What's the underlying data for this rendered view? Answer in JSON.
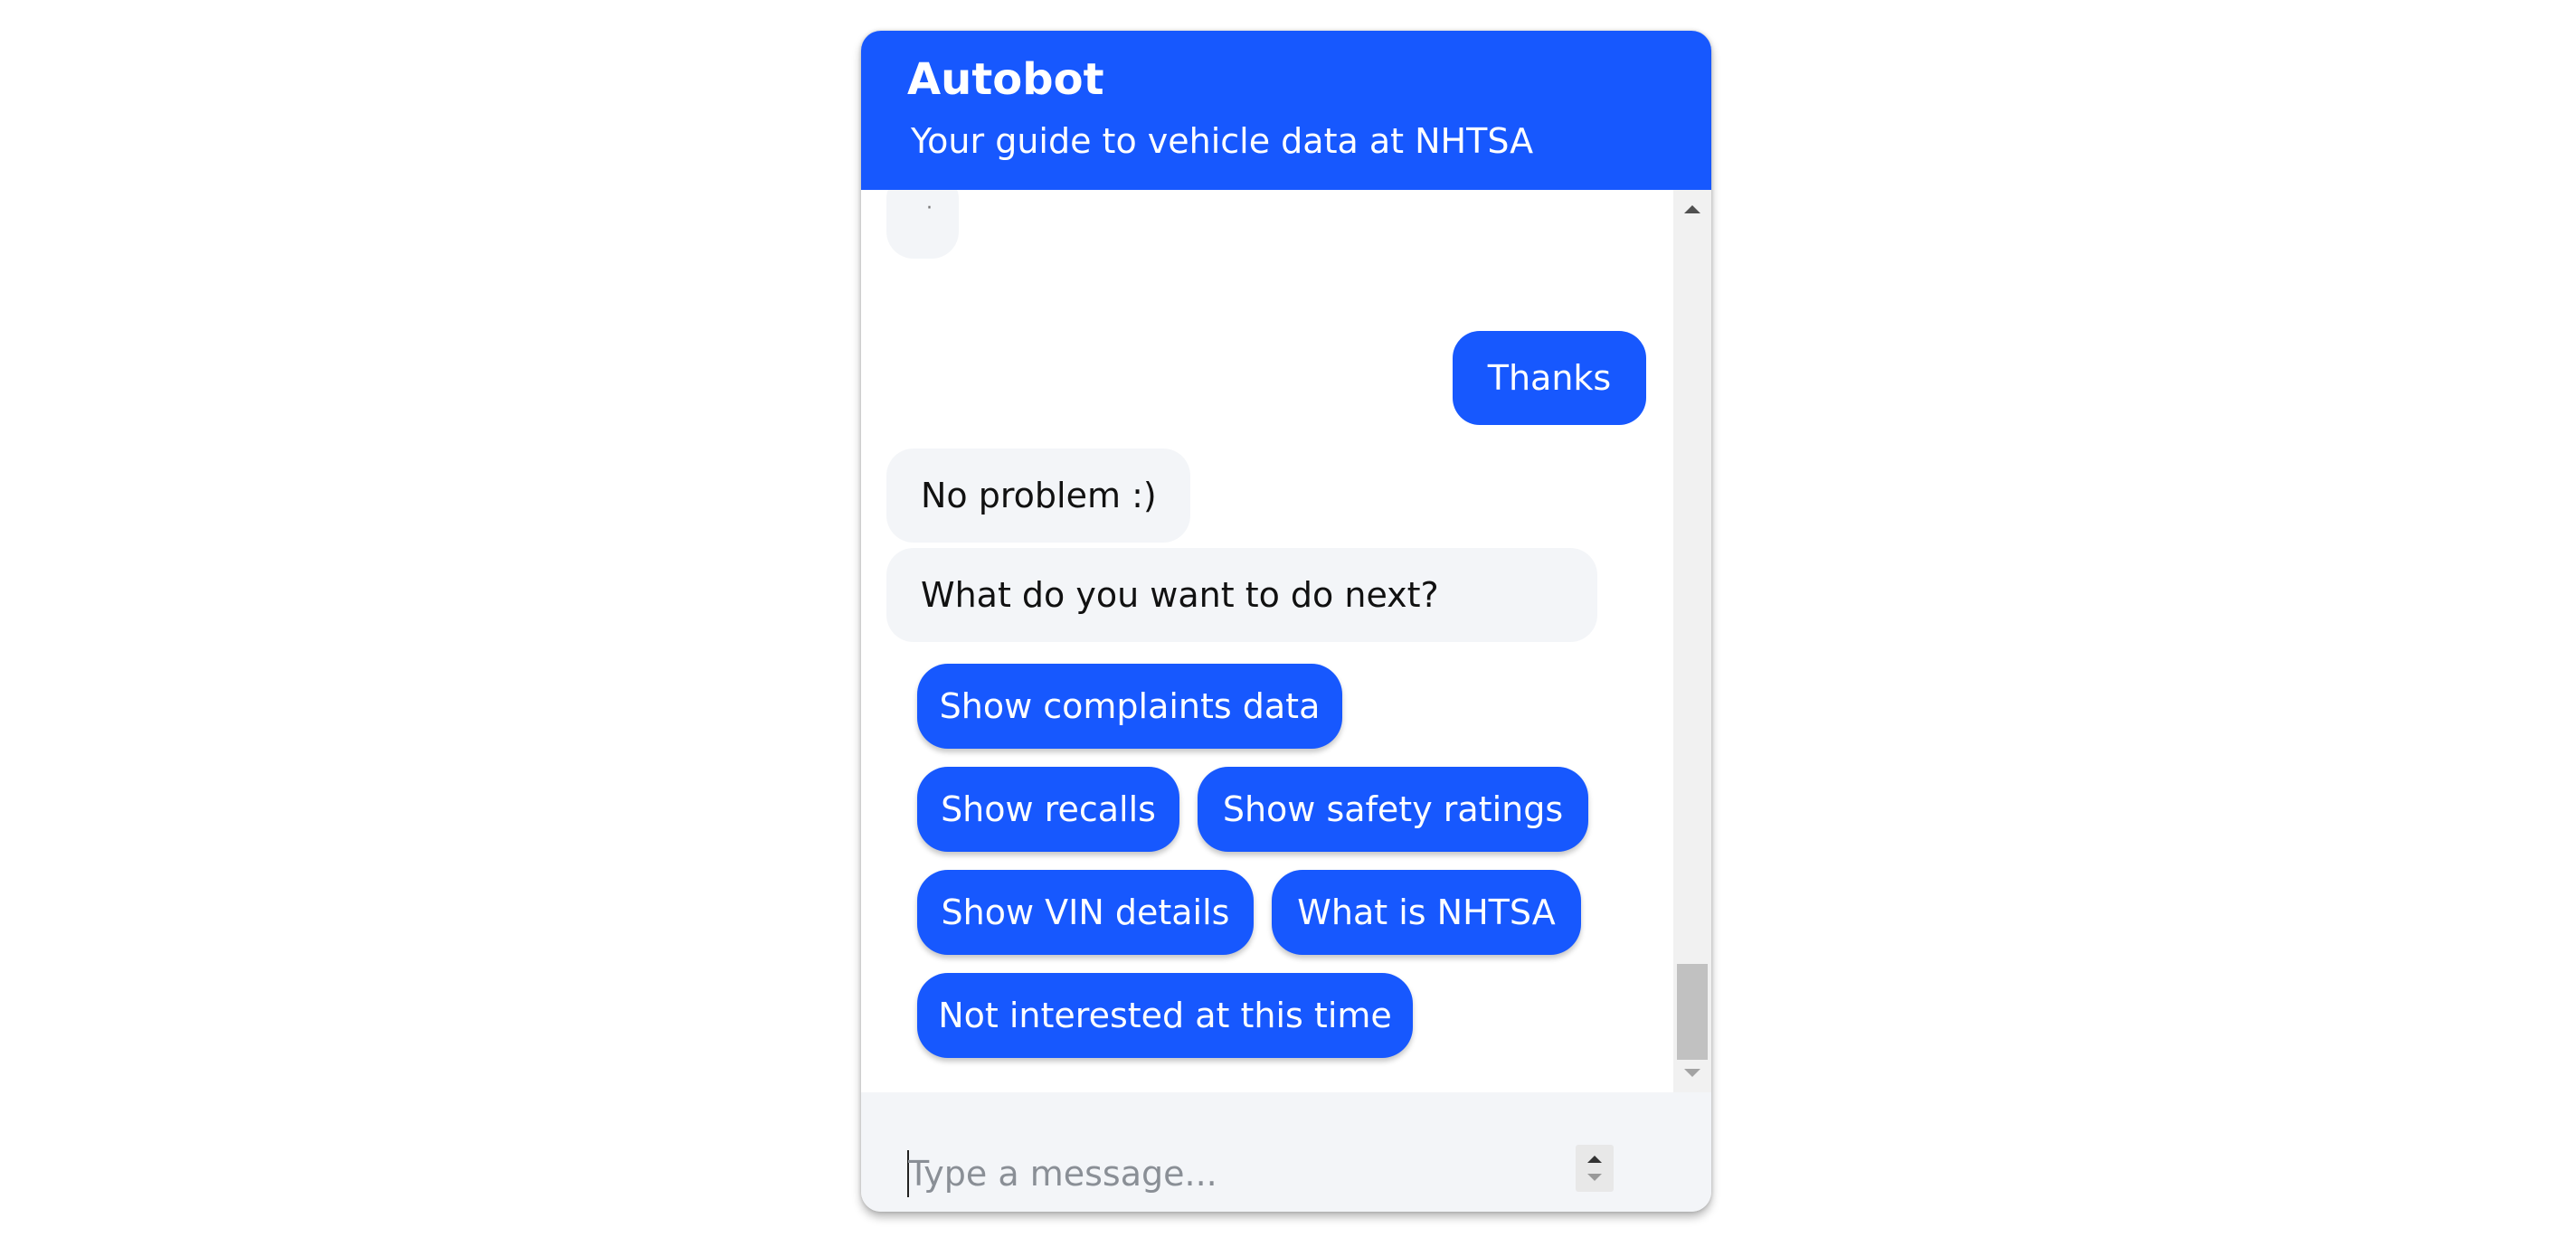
{
  "header": {
    "title": "Autobot",
    "subtitle": "Your guide to vehicle data at NHTSA"
  },
  "messages": {
    "typing_indicator": "·",
    "user_message": "Thanks",
    "bot_reply": "No problem :)",
    "bot_prompt": "What do you want to do next?"
  },
  "quick_replies": [
    "Show complaints data",
    "Show recalls",
    "Show safety ratings",
    "Show VIN details",
    "What is NHTSA",
    "Not interested at this time"
  ],
  "input": {
    "placeholder": "Type a message..."
  },
  "colors": {
    "brand": "#1758fe",
    "bot_bubble": "#f3f5f8",
    "input_background": "#f3f5f8"
  },
  "icons": {
    "scroll_up": "triangle-up-icon",
    "scroll_down": "triangle-down-icon",
    "input_spinner": "stepper-icon"
  }
}
